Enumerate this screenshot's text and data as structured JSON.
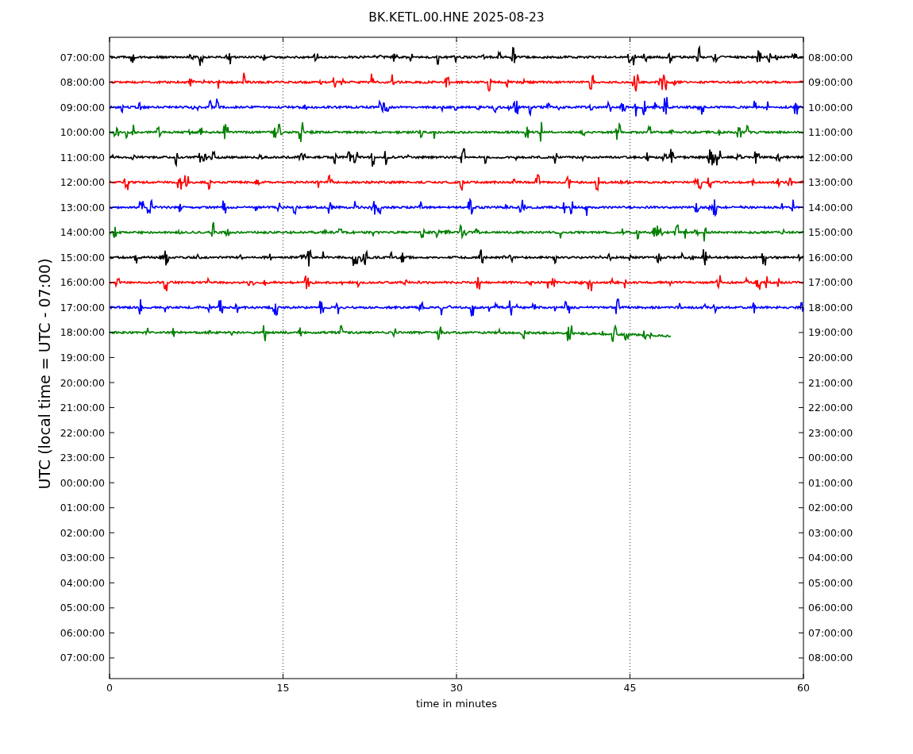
{
  "plot": {
    "title": "BK.KETL.00.HNE 2025-08-23",
    "xlabel": "time in minutes",
    "ylabel": "UTC (local time = UTC - 07:00)",
    "xticks": [
      "0",
      "15",
      "30",
      "45",
      "60"
    ]
  },
  "traces": [
    {
      "color": "#000000",
      "complete": true
    },
    {
      "color": "#ff0000",
      "complete": true
    },
    {
      "color": "#0000ff",
      "complete": true
    },
    {
      "color": "#008000",
      "complete": true
    },
    {
      "color": "#000000",
      "complete": true
    },
    {
      "color": "#ff0000",
      "complete": true
    },
    {
      "color": "#0000ff",
      "complete": true
    },
    {
      "color": "#008000",
      "complete": true
    },
    {
      "color": "#000000",
      "complete": true
    },
    {
      "color": "#ff0000",
      "complete": true
    },
    {
      "color": "#0000ff",
      "complete": true
    },
    {
      "color": "#008000",
      "complete": false
    }
  ],
  "left_yticks": [
    "07:00:00",
    "08:00:00",
    "09:00:00",
    "10:00:00",
    "11:00:00",
    "12:00:00",
    "13:00:00",
    "14:00:00",
    "15:00:00",
    "16:00:00",
    "17:00:00",
    "18:00:00",
    "19:00:00",
    "20:00:00",
    "21:00:00",
    "22:00:00",
    "23:00:00",
    "00:00:00",
    "01:00:00",
    "02:00:00",
    "03:00:00",
    "04:00:00",
    "05:00:00",
    "06:00:00",
    "07:00:00"
  ],
  "right_yticks": [
    "08:00:00",
    "09:00:00",
    "10:00:00",
    "11:00:00",
    "12:00:00",
    "13:00:00",
    "14:00:00",
    "15:00:00",
    "16:00:00",
    "17:00:00",
    "18:00:00",
    "19:00:00",
    "20:00:00",
    "21:00:00",
    "22:00:00",
    "23:00:00",
    "00:00:00",
    "01:00:00",
    "02:00:00",
    "03:00:00",
    "04:00:00",
    "05:00:00",
    "06:00:00",
    "07:00:00",
    "08:00:00"
  ]
}
